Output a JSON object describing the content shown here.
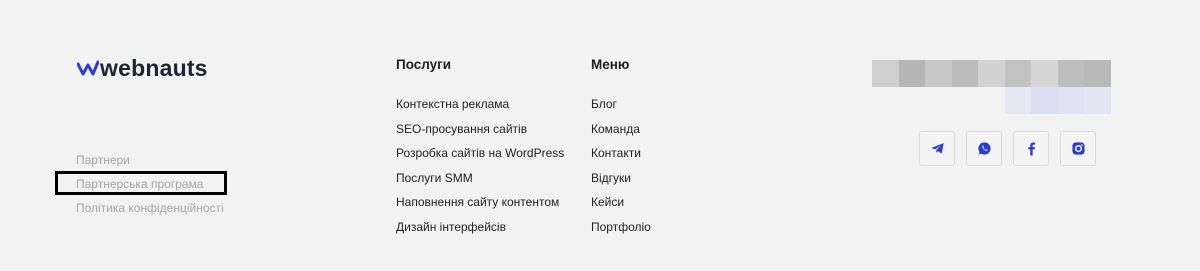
{
  "brand": {
    "name": "webnauts",
    "accent": "#2c3bd6"
  },
  "secondary_links": [
    {
      "label": "Партнери"
    },
    {
      "label": "Партнерська програма"
    },
    {
      "label": "Політика конфіденційності"
    }
  ],
  "services": {
    "title": "Послуги",
    "items": [
      {
        "label": "Контекстна реклама"
      },
      {
        "label": "SEO-просування сайтів"
      },
      {
        "label": "Розробка сайтів на WordPress"
      },
      {
        "label": "Послуги SMM"
      },
      {
        "label": "Наповнення сайту контентом"
      },
      {
        "label": "Дизайн інтерфейсів"
      }
    ]
  },
  "menu": {
    "title": "Меню",
    "items": [
      {
        "label": "Блог"
      },
      {
        "label": "Команда"
      },
      {
        "label": "Контакти"
      },
      {
        "label": "Відгуки"
      },
      {
        "label": "Кейси"
      },
      {
        "label": "Портфоліо"
      }
    ]
  },
  "contact_block": {
    "state": "pixelated",
    "row1_colors": [
      "#cfcfcf",
      "#b6b6b6",
      "#c8c8c8",
      "#bcbcbc",
      "#d2d2d2",
      "#c2c2c2",
      "#d6d6d6",
      "#bdbdbd",
      "#b9b9b9"
    ],
    "row2_colors": [
      "#f2f2f2",
      "#f2f2f2",
      "#f2f2f2",
      "#f2f2f2",
      "#f2f2f2",
      "#e6e7f3",
      "#dcdef2",
      "#e0e2f3",
      "#e4e6f3"
    ]
  },
  "socials": [
    {
      "icon": "telegram-icon",
      "color": "#2c3bd6"
    },
    {
      "icon": "whatsapp-icon",
      "color": "#2c3bd6"
    },
    {
      "icon": "facebook-icon",
      "color": "#2c3bd6"
    },
    {
      "icon": "instagram-icon",
      "color": "#2c3bd6"
    }
  ]
}
